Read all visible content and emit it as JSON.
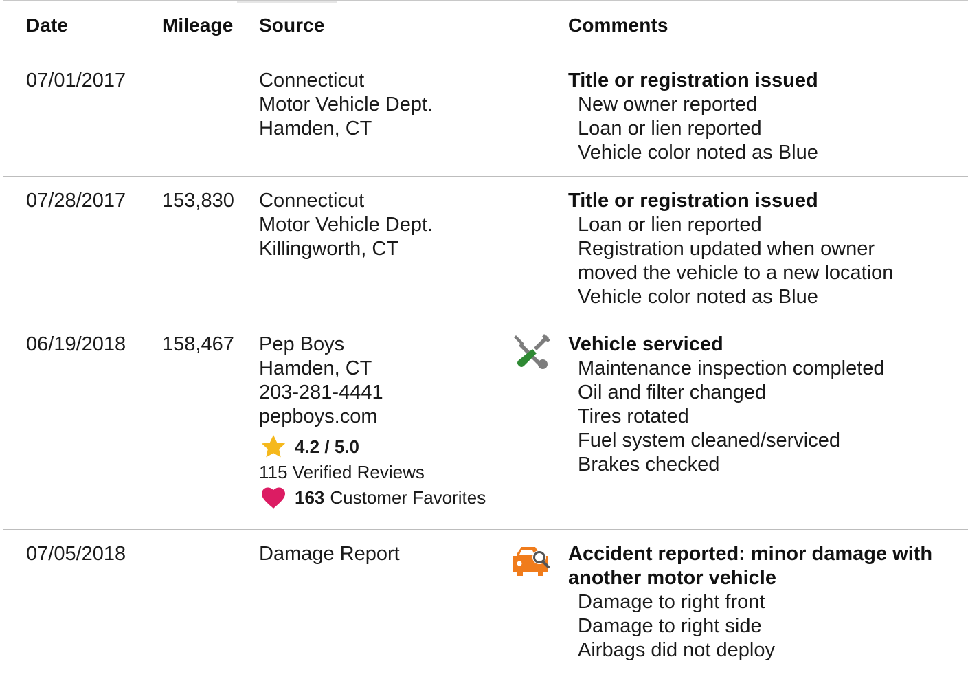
{
  "headers": {
    "date": "Date",
    "mileage": "Mileage",
    "source": "Source",
    "comments": "Comments"
  },
  "rows": [
    {
      "date": "07/01/2017",
      "mileage": "",
      "source": [
        "Connecticut",
        "Motor Vehicle Dept.",
        "Hamden, CT"
      ],
      "icon": "",
      "comment_title": "Title or registration issued",
      "comment_items": [
        "New owner reported",
        "Loan or lien reported",
        "Vehicle color noted as Blue"
      ]
    },
    {
      "date": "07/28/2017",
      "mileage": "153,830",
      "source": [
        "Connecticut",
        "Motor Vehicle Dept.",
        "Killingworth, CT"
      ],
      "icon": "",
      "comment_title": "Title or registration issued",
      "comment_items": [
        "Loan or lien reported",
        "Registration updated when owner",
        "moved the vehicle to a new location",
        "Vehicle color noted as Blue"
      ]
    },
    {
      "date": "06/19/2018",
      "mileage": "158,467",
      "source": [
        "Pep Boys",
        "Hamden, CT",
        "203-281-4441",
        "pepboys.com"
      ],
      "rating": "4.2 / 5.0",
      "reviews": "115 Verified Reviews",
      "favorites_count": "163",
      "favorites_label": "Customer Favorites",
      "icon": "wrench-screwdriver-icon",
      "comment_title": "Vehicle serviced",
      "comment_items": [
        "Maintenance inspection completed",
        "Oil and filter changed",
        "Tires rotated",
        "Fuel system cleaned/serviced",
        "Brakes checked"
      ]
    },
    {
      "date": "07/05/2018",
      "mileage": "",
      "source": [
        "Damage Report"
      ],
      "icon": "car-damage-search-icon",
      "comment_title_lines": [
        "Accident reported: minor damage with",
        "another motor vehicle"
      ],
      "comment_items": [
        "Damage to right front",
        "Damage to right side",
        "Airbags did not deploy"
      ]
    }
  ],
  "colors": {
    "star": "#f5b81c",
    "heart": "#dc1c63",
    "wrench": "#7d7d7d",
    "screwdriver": "#2f8a34",
    "accident": "#f07c1c"
  }
}
